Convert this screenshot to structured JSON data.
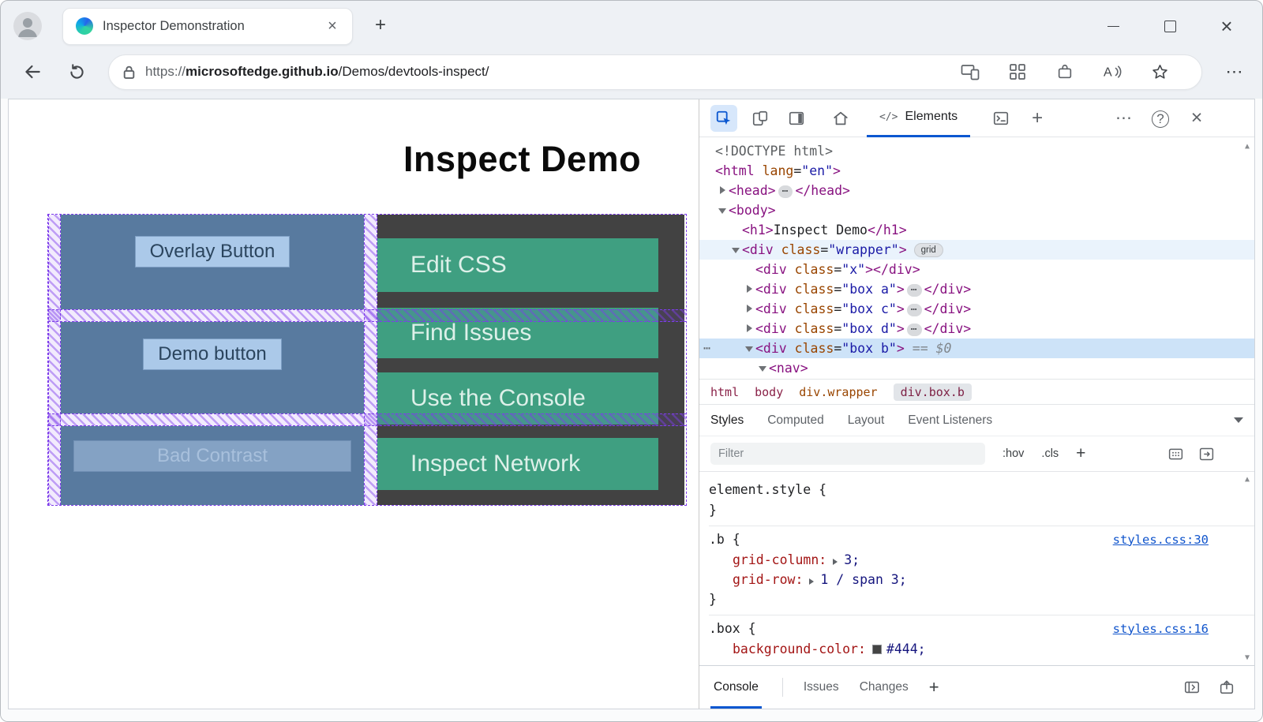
{
  "browser": {
    "tab": {
      "title": "Inspector Demonstration"
    },
    "url": {
      "protocol": "https://",
      "domain": "microsoftedge.github.io",
      "path": "/Demos/devtools-inspect/"
    }
  },
  "page": {
    "heading": "Inspect Demo",
    "boxes": {
      "overlay_button": "Overlay Button",
      "demo_button": "Demo button",
      "bad_contrast_button": "Bad Contrast"
    },
    "nav_links": [
      "Edit CSS",
      "Find Issues",
      "Use the Console",
      "Inspect Network"
    ]
  },
  "devtools": {
    "elements_tab": "Elements",
    "dom_rows": [
      {
        "tokens": [
          {
            "t": "doctype",
            "s": "<!DOCTYPE html>"
          }
        ]
      },
      {
        "tokens": [
          {
            "t": "tag",
            "s": "<html"
          },
          {
            "t": "attr",
            "s": " lang"
          },
          {
            "t": "punc",
            "s": "="
          },
          {
            "t": "val",
            "s": "\"en\""
          },
          {
            "t": "tag",
            "s": ">"
          }
        ]
      },
      {
        "tokens": [
          {
            "t": "tag",
            "s": "<head>"
          },
          {
            "t": "more",
            "s": "⋯"
          },
          {
            "t": "tag",
            "s": "</head>"
          }
        ]
      },
      {
        "tokens": [
          {
            "t": "tag",
            "s": "<body>"
          }
        ]
      },
      {
        "tokens": [
          {
            "t": "tag",
            "s": "<h1>"
          },
          {
            "t": "text",
            "s": "Inspect Demo"
          },
          {
            "t": "tag",
            "s": "</h1>"
          }
        ]
      },
      {
        "tokens": [
          {
            "t": "tag",
            "s": "<div"
          },
          {
            "t": "attr",
            "s": " class"
          },
          {
            "t": "punc",
            "s": "="
          },
          {
            "t": "val",
            "s": "\"wrapper\""
          },
          {
            "t": "tag",
            "s": ">"
          },
          {
            "t": "badge",
            "s": "grid"
          }
        ]
      },
      {
        "tokens": [
          {
            "t": "tag",
            "s": "<div"
          },
          {
            "t": "attr",
            "s": " class"
          },
          {
            "t": "punc",
            "s": "="
          },
          {
            "t": "val",
            "s": "\"x\""
          },
          {
            "t": "tag",
            "s": ">"
          },
          {
            "t": "tag",
            "s": "</div>"
          }
        ]
      },
      {
        "tokens": [
          {
            "t": "tag",
            "s": "<div"
          },
          {
            "t": "attr",
            "s": " class"
          },
          {
            "t": "punc",
            "s": "="
          },
          {
            "t": "val",
            "s": "\"box a\""
          },
          {
            "t": "tag",
            "s": ">"
          },
          {
            "t": "more",
            "s": "⋯"
          },
          {
            "t": "tag",
            "s": "</div>"
          }
        ]
      },
      {
        "tokens": [
          {
            "t": "tag",
            "s": "<div"
          },
          {
            "t": "attr",
            "s": " class"
          },
          {
            "t": "punc",
            "s": "="
          },
          {
            "t": "val",
            "s": "\"box c\""
          },
          {
            "t": "tag",
            "s": ">"
          },
          {
            "t": "more",
            "s": "⋯"
          },
          {
            "t": "tag",
            "s": "</div>"
          }
        ]
      },
      {
        "tokens": [
          {
            "t": "tag",
            "s": "<div"
          },
          {
            "t": "attr",
            "s": " class"
          },
          {
            "t": "punc",
            "s": "="
          },
          {
            "t": "val",
            "s": "\"box d\""
          },
          {
            "t": "tag",
            "s": ">"
          },
          {
            "t": "more",
            "s": "⋯"
          },
          {
            "t": "tag",
            "s": "</div>"
          }
        ]
      },
      {
        "tokens": [
          {
            "t": "tag",
            "s": "<div"
          },
          {
            "t": "attr",
            "s": " class"
          },
          {
            "t": "punc",
            "s": "="
          },
          {
            "t": "val",
            "s": "\"box b\""
          },
          {
            "t": "tag",
            "s": ">"
          },
          {
            "t": "eq",
            "s": "== $0"
          }
        ]
      },
      {
        "tokens": [
          {
            "t": "tag",
            "s": "<nav>"
          }
        ]
      }
    ],
    "breadcrumbs": [
      "html",
      "body",
      "div.wrapper",
      "div.box.b"
    ],
    "panel_tabs": [
      "Styles",
      "Computed",
      "Layout",
      "Event Listeners"
    ],
    "filter_placeholder": "Filter",
    "pseudo_button": ":hov",
    "class_button": ".cls",
    "rules": [
      {
        "open": "element.style {",
        "close": "}",
        "link": ""
      },
      {
        "open": ".b {",
        "close": "}",
        "link": "styles.css:30",
        "props": [
          {
            "name": "grid-column:",
            "value": "3;"
          },
          {
            "name": "grid-row:",
            "value": "1 / span 3;"
          }
        ]
      },
      {
        "open": ".box {",
        "close": "}",
        "link": "styles.css:16",
        "props": [
          {
            "name": "background-color:",
            "value": "#444;",
            "swatch": "#444444"
          }
        ]
      }
    ],
    "drawer_tabs": [
      "Console",
      "Issues",
      "Changes"
    ]
  },
  "colors": {
    "accent_blue": "#0b57d0",
    "grid_overlay_purple": "#7d3ceb",
    "demo_box_blue": "#587a9f",
    "demo_box_teal": "#3f9f81",
    "demo_box_dark": "#444444",
    "selected_node_bg": "#cde3f8"
  }
}
